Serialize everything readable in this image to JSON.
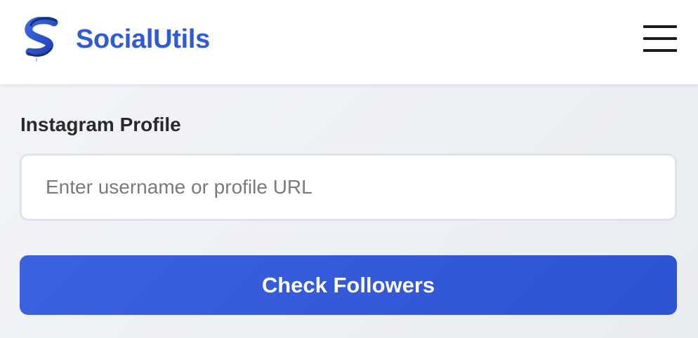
{
  "header": {
    "brand": "SocialUtils",
    "logo_icon": "social-utils-logo-icon",
    "menu_icon": "hamburger-menu-icon"
  },
  "form": {
    "label": "Instagram Profile",
    "input_placeholder": "Enter username or profile URL",
    "input_value": "",
    "submit_label": "Check Followers"
  },
  "colors": {
    "brand": "#2f5bd8",
    "button": "#3b62e2",
    "label_text": "#2a2a2a",
    "placeholder": "#7a7a7a"
  }
}
